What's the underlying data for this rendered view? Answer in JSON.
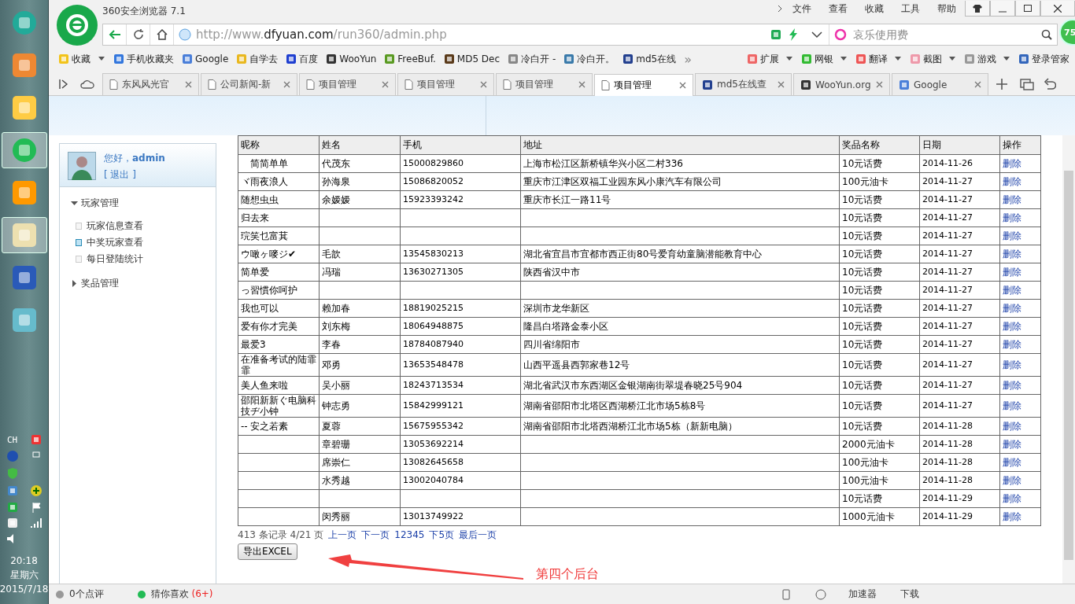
{
  "taskbar": {
    "input_lang": "CH",
    "time": "20:18",
    "weekday": "星期六",
    "date": "2015/7/18"
  },
  "window": {
    "title": "360安全浏览器 7.1",
    "menu": [
      "文件",
      "查看",
      "收藏",
      "工具",
      "帮助"
    ],
    "badge": "75"
  },
  "address": {
    "prefix": "http://www.",
    "domain": "dfyuan.com",
    "path": "/run360/admin.php"
  },
  "search": {
    "placeholder": "哀乐使用费"
  },
  "bookmarks": [
    "收藏",
    "手机收藏夹",
    "Google",
    "自学去",
    "百度",
    "WooYun",
    "FreeBuf.",
    "MD5 Dec",
    "冷白开 -",
    "冷白开。",
    "md5在线"
  ],
  "bookmarks_more": "»",
  "tools": [
    "扩展",
    "网银",
    "翻译",
    "截图",
    "游戏",
    "登录管家"
  ],
  "tabs": [
    {
      "label": "东风风光官",
      "selected": false
    },
    {
      "label": "公司新闻-新",
      "selected": false
    },
    {
      "label": "项目管理",
      "selected": false
    },
    {
      "label": "项目管理",
      "selected": false
    },
    {
      "label": "项目管理",
      "selected": false
    },
    {
      "label": "项目管理",
      "selected": true
    },
    {
      "label": "md5在线查",
      "selected": false
    },
    {
      "label": "WooYun.org",
      "selected": false
    },
    {
      "label": "Google",
      "selected": false
    }
  ],
  "sidebar": {
    "greeting": "您好，**admin**",
    "logout": "[ 退出 ]",
    "menu": [
      {
        "label": "玩家管理",
        "expanded": true,
        "children": [
          {
            "label": "玩家信息查看",
            "selected": false
          },
          {
            "label": "中奖玩家查看",
            "selected": true
          },
          {
            "label": "每日登陆统计",
            "selected": false
          }
        ]
      },
      {
        "label": "奖品管理",
        "expanded": false
      }
    ]
  },
  "table": {
    "columns": [
      "昵称",
      "姓名",
      "手机",
      "地址",
      "奖品名称",
      "日期",
      "操作"
    ],
    "rows": [
      {
        "nickname": "　简简单单",
        "name": "代茂东",
        "phone": "15000829860",
        "address": "上海市松江区新桥镇华兴小区二村336",
        "prize": "10元话费",
        "date": "2014-11-26",
        "action": "删除"
      },
      {
        "nickname": "ヾ雨夜浪人",
        "name": "孙海泉",
        "phone": "15086820052",
        "address": "重庆市江津区双福工业园东风小康汽车有限公司",
        "prize": "100元油卡",
        "date": "2014-11-27",
        "action": "删除"
      },
      {
        "nickname": "随想虫虫",
        "name": "余嫒嫒",
        "phone": "15923393242",
        "address": "重庆市长江一路11号",
        "prize": "10元话费",
        "date": "2014-11-27",
        "action": "删除"
      },
      {
        "nickname": "归去来",
        "prize": "10元话费",
        "date": "2014-11-27",
        "action": "删除"
      },
      {
        "nickname": "琓笑乜富萁",
        "prize": "10元话费",
        "date": "2014-11-27",
        "action": "删除"
      },
      {
        "nickname": "ウ噉ヶ嘜ジ✔",
        "name": "毛歆",
        "phone": "13545830213",
        "address": "湖北省宜昌市宜都市西正街80号爱育幼童脑潜能教育中心",
        "prize": "10元话费",
        "date": "2014-11-27",
        "action": "删除"
      },
      {
        "nickname": "简单爱",
        "name": "冯瑞",
        "phone": "13630271305",
        "address": "陕西省汉中市",
        "prize": "10元话费",
        "date": "2014-11-27",
        "action": "删除"
      },
      {
        "nickname": "っ習慣你呵护",
        "prize": "10元话费",
        "date": "2014-11-27",
        "action": "删除"
      },
      {
        "nickname": "我也可以",
        "name": "赖加春",
        "phone": "18819025215",
        "address": "深圳市龙华新区",
        "prize": "10元话费",
        "date": "2014-11-27",
        "action": "删除"
      },
      {
        "nickname": "爱有你才完美",
        "name": "刘东梅",
        "phone": "18064948875",
        "address": "隆昌白塔路金泰小区",
        "prize": "10元话费",
        "date": "2014-11-27",
        "action": "删除"
      },
      {
        "nickname": "最爱3",
        "name": "李春",
        "phone": "18784087940",
        "address": "四川省绵阳市",
        "prize": "10元话费",
        "date": "2014-11-27",
        "action": "删除"
      },
      {
        "nickname": "在准备考试的陆霏霏",
        "name": "邓勇",
        "phone": "13653548478",
        "address": "山西平遥县西郭家巷12号",
        "prize": "10元话费",
        "date": "2014-11-27",
        "action": "删除"
      },
      {
        "nickname": "美人鱼来啦",
        "name": "吴小丽",
        "phone": "18243713534",
        "address": "湖北省武汉市东西湖区金银湖南街翠堤春晓25号904",
        "prize": "10元话费",
        "date": "2014-11-27",
        "action": "删除"
      },
      {
        "nickname": "邵阳新新ぐ电脑科技ヂ小钟",
        "name": "钟志勇",
        "phone": "15842999121",
        "address": "湖南省邵阳市北塔区西湖桥江北市场5栋8号",
        "prize": "10元话费",
        "date": "2014-11-27",
        "action": "删除"
      },
      {
        "nickname": "-- 安之若素",
        "name": "夏蓉",
        "phone": "15675955342",
        "address": "湖南省邵阳市北塔西湖桥江北市场5栋（新新电脑）",
        "prize": "10元话费",
        "date": "2014-11-28",
        "action": "删除"
      },
      {
        "name": "章碧珊",
        "phone": "13053692214",
        "prize": "2000元油卡",
        "date": "2014-11-28",
        "action": "删除"
      },
      {
        "name": "席崇仁",
        "phone": "13082645658",
        "prize": "100元油卡",
        "date": "2014-11-28",
        "action": "删除"
      },
      {
        "name": "水秀越",
        "phone": "13002040784",
        "prize": "100元油卡",
        "date": "2014-11-28",
        "action": "删除"
      },
      {
        "prize": "10元话费",
        "date": "2014-11-29",
        "action": "删除"
      },
      {
        "name": "闵秀丽",
        "phone": "13013749922",
        "prize": "1000元油卡",
        "date": "2014-11-29",
        "action": "删除"
      }
    ]
  },
  "pager": {
    "summary": "413 条记录 4/21 页",
    "links": [
      "上一页",
      "下一页",
      "12345",
      "下5页",
      "最后一页"
    ]
  },
  "export_button": "导出EXCEL",
  "annotation": "第四个后台",
  "status_bar": {
    "comments": "0个点评",
    "likes": "猜你喜欢",
    "likes_count": "(6+)",
    "right": [
      "加速器",
      "下载"
    ]
  }
}
